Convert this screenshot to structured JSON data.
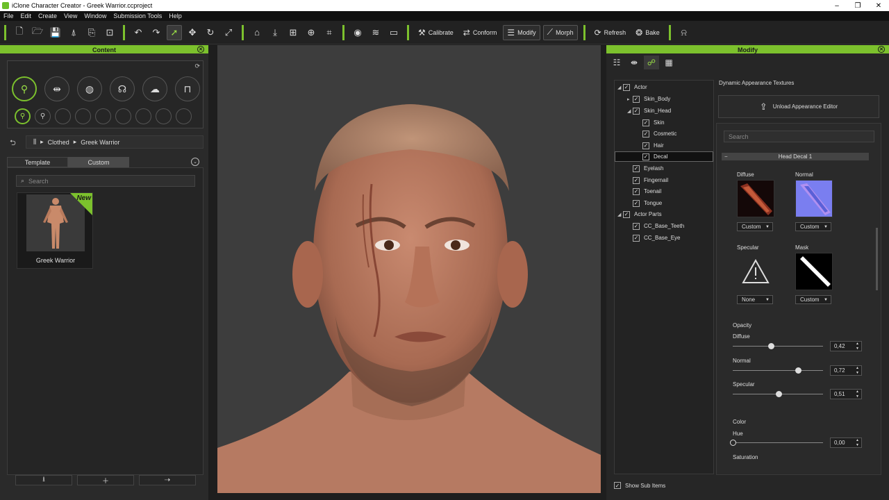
{
  "window": {
    "title": "iClone Character Creator - Greek Warrior.ccproject",
    "buttons": {
      "minimize": "–",
      "restore": "❐",
      "close": "✕"
    }
  },
  "menu": [
    "File",
    "Edit",
    "Create",
    "View",
    "Window",
    "Submission Tools",
    "Help"
  ],
  "toolbar": {
    "calibrate": "Calibrate",
    "conform": "Conform",
    "modify": "Modify",
    "morph": "Morph",
    "refresh": "Refresh",
    "bake": "Bake"
  },
  "content_panel": {
    "title": "Content",
    "breadcrumb": [
      "Clothed",
      "Greek Warrior"
    ],
    "tabs": {
      "template": "Template",
      "custom": "Custom"
    },
    "search_placeholder": "Search",
    "items": [
      {
        "label": "Greek Warrior",
        "badge": "New"
      }
    ]
  },
  "modify_panel": {
    "title": "Modify",
    "tree": [
      {
        "label": "Actor"
      },
      {
        "label": "Skin_Body"
      },
      {
        "label": "Skin_Head"
      },
      {
        "label": "Skin"
      },
      {
        "label": "Cosmetic"
      },
      {
        "label": "Hair"
      },
      {
        "label": "Decal"
      },
      {
        "label": "Eyelash"
      },
      {
        "label": "Fingernail"
      },
      {
        "label": "Toenail"
      },
      {
        "label": "Tongue"
      },
      {
        "label": "Actor Parts"
      },
      {
        "label": "CC_Base_Teeth"
      },
      {
        "label": "CC_Base_Eye"
      }
    ],
    "section_title": "Dynamic Appearance Textures",
    "unload_label": "Unload Appearance Editor",
    "search_placeholder": "Search",
    "decal_header": "Head Decal 1",
    "textures": {
      "diffuse": {
        "label": "Diffuse",
        "mode": "Custom"
      },
      "normal": {
        "label": "Normal",
        "mode": "Custom"
      },
      "specular": {
        "label": "Specular",
        "mode": "None"
      },
      "mask": {
        "label": "Mask",
        "mode": "Custom"
      }
    },
    "opacity_label": "Opacity",
    "sliders": {
      "diffuse": {
        "label": "Diffuse",
        "value": "0,42",
        "level": 0.42
      },
      "normal": {
        "label": "Normal",
        "value": "0,72",
        "level": 0.72
      },
      "specular": {
        "label": "Specular",
        "value": "0,51",
        "level": 0.51
      },
      "hue": {
        "label": "Hue",
        "value": "0,00",
        "level": 0.0
      }
    },
    "color_label": "Color",
    "saturation_label": "Saturation",
    "show_sub_items": "Show Sub Items"
  },
  "colors": {
    "accent": "#7cc12d",
    "viewport_bg": "#3d3d3d"
  }
}
